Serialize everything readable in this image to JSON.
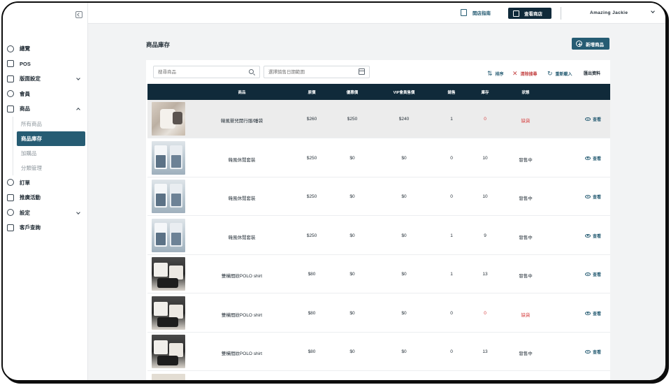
{
  "sidebar": {
    "items": [
      {
        "label": "總覽",
        "icon": "dashboard-icon"
      },
      {
        "label": "POS",
        "icon": "pos-icon"
      },
      {
        "label": "版面設定",
        "icon": "layers-icon"
      },
      {
        "label": "會員",
        "icon": "member-icon"
      },
      {
        "label": "商品",
        "icon": "box-icon"
      },
      {
        "label": "訂單",
        "icon": "order-icon"
      },
      {
        "label": "推廣活動",
        "icon": "gift-icon"
      },
      {
        "label": "設定",
        "icon": "gear-icon"
      },
      {
        "label": "客戶查詢",
        "icon": "customer-icon"
      }
    ],
    "product_sub": [
      "所有商品",
      "商品庫存",
      "加購品",
      "分類管理"
    ]
  },
  "topbar": {
    "guide_label": "開店指南",
    "store_label": "查看商店",
    "user_name": "Amazing Jackie"
  },
  "main": {
    "page_title": "商品庫存",
    "new_button": "新增商品",
    "search_placeholder": "搜尋商品",
    "date_placeholder": "選擇銷售日期範圍",
    "toolbar": {
      "sort": "排序",
      "clear": "清除搜尋",
      "reload": "重新載入",
      "export": "匯出資料"
    },
    "columns": [
      "商品",
      "原價",
      "優惠價",
      "VIP會員售價",
      "銷售",
      "庫存",
      "狀態"
    ],
    "view_label": "查看",
    "rows": [
      {
        "name": "韓風嬰兒開行服/睡袋",
        "price": "$260",
        "sale": "$250",
        "vip": "$240",
        "sold": "1",
        "stock": "0",
        "status": "缺貨",
        "thumb": "beige"
      },
      {
        "name": "韓風休閒套裝",
        "price": "$250",
        "sale": "$0",
        "vip": "$0",
        "sold": "0",
        "stock": "10",
        "status": "發售中",
        "thumb": "kids"
      },
      {
        "name": "韓風休閒套裝",
        "price": "$250",
        "sale": "$0",
        "vip": "$0",
        "sold": "0",
        "stock": "10",
        "status": "發售中",
        "thumb": "kids"
      },
      {
        "name": "韓風休閒套裝",
        "price": "$250",
        "sale": "$0",
        "vip": "$0",
        "sold": "1",
        "stock": "9",
        "status": "發售中",
        "thumb": "kids"
      },
      {
        "name": "雙橫間紋POLO shirt",
        "price": "$80",
        "sale": "$0",
        "vip": "$0",
        "sold": "1",
        "stock": "13",
        "status": "發售中",
        "thumb": "polo"
      },
      {
        "name": "雙橫間紋POLO shirt",
        "price": "$80",
        "sale": "$0",
        "vip": "$0",
        "sold": "0",
        "stock": "0",
        "status": "缺貨",
        "thumb": "polo"
      },
      {
        "name": "雙橫間紋POLO shirt",
        "price": "$80",
        "sale": "$0",
        "vip": "$0",
        "sold": "0",
        "stock": "13",
        "status": "發售中",
        "thumb": "polo"
      }
    ]
  },
  "colors": {
    "accent": "#265c73",
    "header_dark": "#102a3a",
    "danger": "#d64141"
  }
}
